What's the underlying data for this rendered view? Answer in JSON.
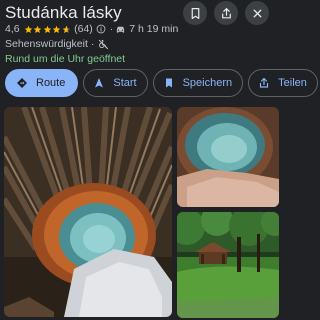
{
  "place": {
    "title": "Studánka lásky",
    "rating": "4,6",
    "reviews": "(64)",
    "drive_time": "7 h 19 min",
    "category": "Sehenswürdigkeit",
    "hours": "Rund um die Uhr geöffnet"
  },
  "header_icons": [
    "bookmark-icon",
    "share-icon",
    "close-icon"
  ],
  "actions": {
    "route": "Route",
    "start": "Start",
    "save": "Speichern",
    "share": "Teilen"
  },
  "colors": {
    "background": "#202124",
    "accent": "#8ab4f8",
    "stars": "#fbbc04",
    "open": "#81c995"
  }
}
